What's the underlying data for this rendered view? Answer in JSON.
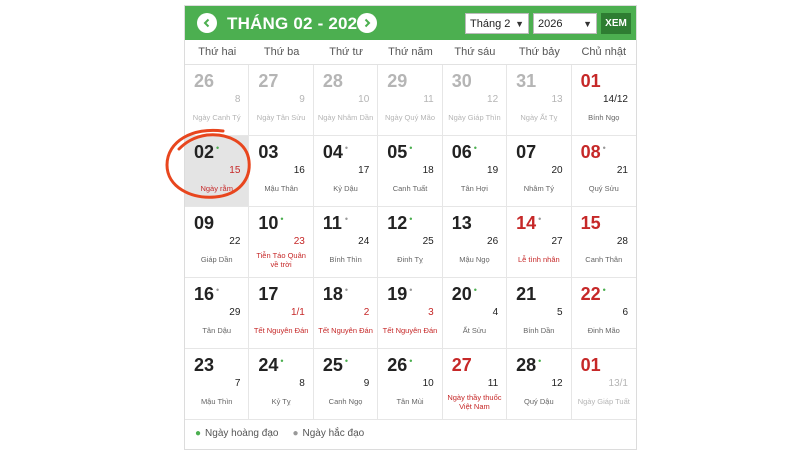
{
  "header": {
    "title": "THÁNG 02 - 2026",
    "month_select": "Tháng 2",
    "year_select": "2026",
    "view_button": "XEM",
    "accent_color": "#4caf50",
    "button_color": "#2e7d32"
  },
  "weekdays": [
    "Thứ hai",
    "Thứ ba",
    "Thứ tư",
    "Thứ năm",
    "Thứ sáu",
    "Thứ bảy",
    "Chủ nhật"
  ],
  "days": [
    {
      "solar": "26",
      "lunar": "8",
      "canchi": "Ngày Canh Tý",
      "other": true
    },
    {
      "solar": "27",
      "lunar": "9",
      "canchi": "Ngày Tân Sửu",
      "other": true
    },
    {
      "solar": "28",
      "lunar": "10",
      "canchi": "Ngày Nhâm Dần",
      "other": true
    },
    {
      "solar": "29",
      "lunar": "11",
      "canchi": "Ngày Quý Mão",
      "other": true
    },
    {
      "solar": "30",
      "lunar": "12",
      "canchi": "Ngày Giáp Thìn",
      "other": true
    },
    {
      "solar": "31",
      "lunar": "13",
      "canchi": "Ngày Ất Tỵ",
      "other": true
    },
    {
      "solar": "01",
      "lunar": "14/12",
      "canchi": "Bính Ngọ",
      "red": true
    },
    {
      "solar": "02",
      "dot": "good",
      "lunar": "15",
      "lunar_red": true,
      "event": "Ngày rằm",
      "selected": true
    },
    {
      "solar": "03",
      "lunar": "16",
      "canchi": "Mậu Thân"
    },
    {
      "solar": "04",
      "dot": "bad",
      "lunar": "17",
      "canchi": "Kỷ Dậu"
    },
    {
      "solar": "05",
      "dot": "good",
      "lunar": "18",
      "canchi": "Canh Tuất"
    },
    {
      "solar": "06",
      "dot": "good",
      "lunar": "19",
      "canchi": "Tân Hợi"
    },
    {
      "solar": "07",
      "lunar": "20",
      "canchi": "Nhâm Tý"
    },
    {
      "solar": "08",
      "dot": "bad",
      "lunar": "21",
      "canchi": "Quý Sửu",
      "red": true
    },
    {
      "solar": "09",
      "lunar": "22",
      "canchi": "Giáp Dần"
    },
    {
      "solar": "10",
      "dot": "good",
      "lunar": "23",
      "lunar_red": true,
      "event": "Tiễn Táo Quân về trời"
    },
    {
      "solar": "11",
      "dot": "bad",
      "lunar": "24",
      "canchi": "Bính Thìn"
    },
    {
      "solar": "12",
      "dot": "good",
      "lunar": "25",
      "canchi": "Đinh Tỵ"
    },
    {
      "solar": "13",
      "lunar": "26",
      "canchi": "Mậu Ngọ"
    },
    {
      "solar": "14",
      "dot": "bad",
      "lunar": "27",
      "event": "Lễ tình nhân",
      "red": true
    },
    {
      "solar": "15",
      "lunar": "28",
      "canchi": "Canh Thân",
      "red": true
    },
    {
      "solar": "16",
      "dot": "bad",
      "lunar": "29",
      "canchi": "Tân Dậu"
    },
    {
      "solar": "17",
      "lunar": "1/1",
      "lunar_red": true,
      "event": "Tết Nguyên Đán"
    },
    {
      "solar": "18",
      "dot": "bad",
      "lunar": "2",
      "lunar_red": true,
      "event": "Tết Nguyên Đán"
    },
    {
      "solar": "19",
      "dot": "bad",
      "lunar": "3",
      "lunar_red": true,
      "event": "Tết Nguyên Đán"
    },
    {
      "solar": "20",
      "dot": "good",
      "lunar": "4",
      "canchi": "Ất Sửu"
    },
    {
      "solar": "21",
      "lunar": "5",
      "canchi": "Bính Dần"
    },
    {
      "solar": "22",
      "dot": "good",
      "lunar": "6",
      "canchi": "Đinh Mão",
      "red": true
    },
    {
      "solar": "23",
      "lunar": "7",
      "canchi": "Mậu Thìn"
    },
    {
      "solar": "24",
      "dot": "good",
      "lunar": "8",
      "canchi": "Kỷ Tỵ"
    },
    {
      "solar": "25",
      "dot": "good",
      "lunar": "9",
      "canchi": "Canh Ngọ"
    },
    {
      "solar": "26",
      "dot": "good",
      "lunar": "10",
      "canchi": "Tân Mùi"
    },
    {
      "solar": "27",
      "lunar": "11",
      "event": "Ngày thầy thuốc Việt Nam",
      "red": true
    },
    {
      "solar": "28",
      "dot": "good",
      "lunar": "12",
      "canchi": "Quý Dậu"
    },
    {
      "solar": "01",
      "lunar": "13/1",
      "canchi": "Ngày Giáp Tuất",
      "other": true,
      "red": true
    }
  ],
  "legend": {
    "good_label": "Ngày hoàng đạo",
    "bad_label": "Ngày hắc đạo"
  }
}
